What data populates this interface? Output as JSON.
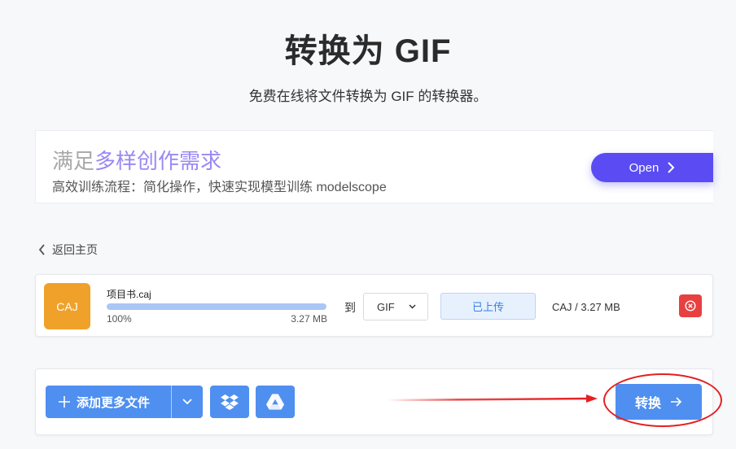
{
  "page": {
    "title": "转换为 GIF",
    "subtitle": "免费在线将文件转换为 GIF 的转换器。"
  },
  "ad": {
    "headline_plain": "满足",
    "headline_accent": "多样创作需求",
    "description": "高效训练流程：简化操作，快速实现模型训练 modelscope",
    "open_label": "Open"
  },
  "nav": {
    "back_label": "返回主页"
  },
  "file": {
    "thumb_label": "CAJ",
    "name": "项目书.caj",
    "progress_percent": 100,
    "progress_label": "100%",
    "size": "3.27 MB",
    "to_label": "到",
    "target_format": "GIF",
    "status": "已上传",
    "info": "CAJ / 3.27 MB"
  },
  "actions": {
    "add_more_label": "添加更多文件",
    "convert_label": "转换"
  },
  "colors": {
    "primary": "#4f8ff0",
    "ad_accent": "#9b87f5",
    "ad_button": "#5a4cf2",
    "file_thumb": "#f0a12a",
    "danger": "#e84040",
    "annotation": "#e42020"
  },
  "icons": {
    "back": "chevron-left-icon",
    "open": "chevron-right-icon",
    "select": "chevron-down-icon",
    "remove": "close-circle-icon",
    "add": "plus-icon",
    "dropbox": "dropbox-icon",
    "drive": "google-drive-icon",
    "convert": "arrow-right-icon"
  }
}
